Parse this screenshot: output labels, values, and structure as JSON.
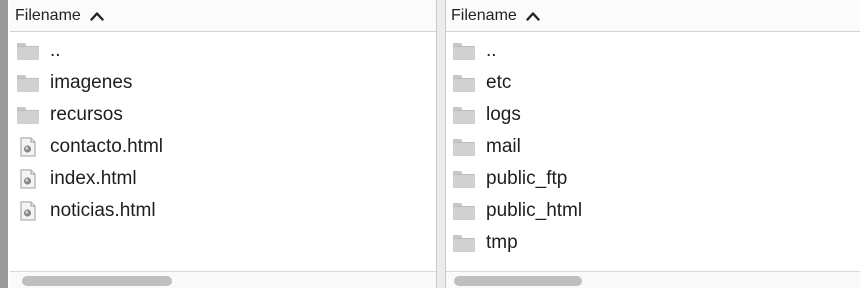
{
  "left_pane": {
    "header": {
      "label": "Filename",
      "sort_icon": "chevron-up-icon"
    },
    "items": [
      {
        "name": "..",
        "type": "folder"
      },
      {
        "name": "imagenes",
        "type": "folder"
      },
      {
        "name": "recursos",
        "type": "folder"
      },
      {
        "name": "contacto.html",
        "type": "file"
      },
      {
        "name": "index.html",
        "type": "file"
      },
      {
        "name": "noticias.html",
        "type": "file"
      }
    ]
  },
  "right_pane": {
    "header": {
      "label": "Filename",
      "sort_icon": "chevron-up-icon"
    },
    "items": [
      {
        "name": "..",
        "type": "folder"
      },
      {
        "name": "etc",
        "type": "folder"
      },
      {
        "name": "logs",
        "type": "folder"
      },
      {
        "name": "mail",
        "type": "folder"
      },
      {
        "name": "public_ftp",
        "type": "folder"
      },
      {
        "name": "public_html",
        "type": "folder"
      },
      {
        "name": "tmp",
        "type": "folder"
      }
    ]
  },
  "colors": {
    "folder": "#d1d1d1",
    "divider": "#ececec",
    "scroll_thumb": "#bfbfbf"
  }
}
